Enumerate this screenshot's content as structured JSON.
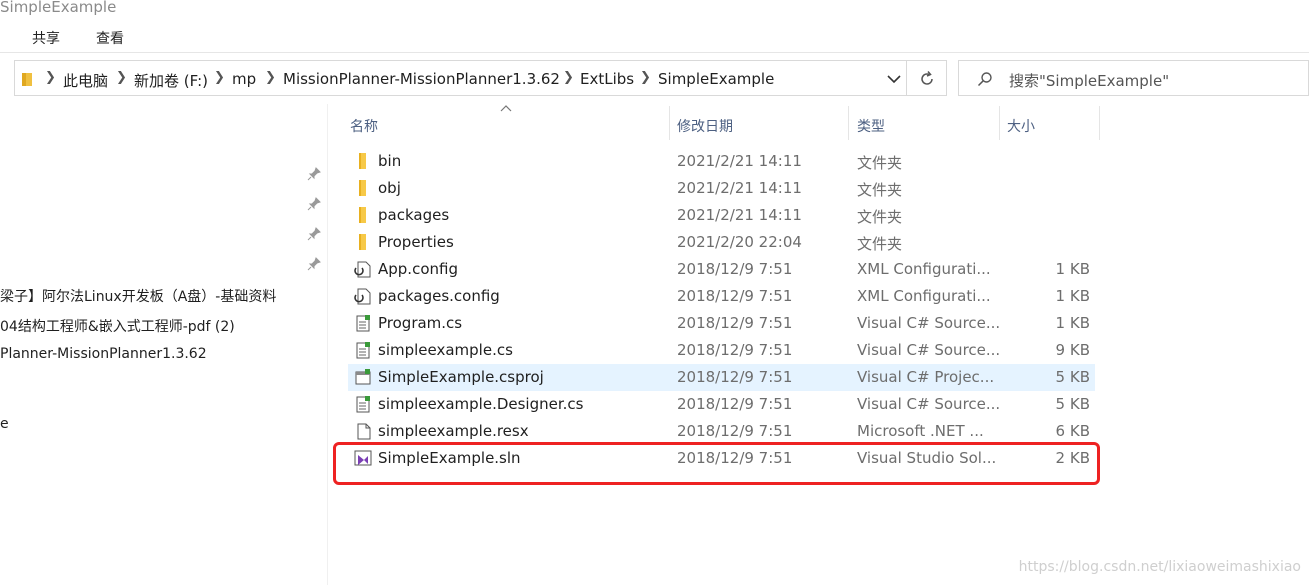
{
  "window": {
    "title": "SimpleExample"
  },
  "ribbon": {
    "tabs": [
      "共享",
      "查看"
    ]
  },
  "address_bar": {
    "breadcrumbs": [
      "此电脑",
      "新加卷 (F:)",
      "mp",
      "MissionPlanner-MissionPlanner1.3.62",
      "ExtLibs",
      "SimpleExample"
    ]
  },
  "search": {
    "placeholder": "搜索\"SimpleExample\""
  },
  "nav_pane": {
    "items": [
      "梁子】阿尔法Linux开发板（A盘）-基础资料",
      "04结构工程师&嵌入式工程师-pdf (2)",
      "Planner-MissionPlanner1.3.62",
      "e"
    ]
  },
  "columns": {
    "name": "名称",
    "date": "修改日期",
    "type": "类型",
    "size": "大小"
  },
  "files": [
    {
      "name": "bin",
      "date": "2021/2/21 14:11",
      "type": "文件夹",
      "size": "",
      "icon": "folder-icon"
    },
    {
      "name": "obj",
      "date": "2021/2/21 14:11",
      "type": "文件夹",
      "size": "",
      "icon": "folder-icon"
    },
    {
      "name": "packages",
      "date": "2021/2/21 14:11",
      "type": "文件夹",
      "size": "",
      "icon": "folder-icon"
    },
    {
      "name": "Properties",
      "date": "2021/2/20 22:04",
      "type": "文件夹",
      "size": "",
      "icon": "folder-icon"
    },
    {
      "name": "App.config",
      "date": "2018/12/9 7:51",
      "type": "XML Configurati...",
      "size": "1 KB",
      "icon": "config-file-icon"
    },
    {
      "name": "packages.config",
      "date": "2018/12/9 7:51",
      "type": "XML Configurati...",
      "size": "1 KB",
      "icon": "config-file-icon"
    },
    {
      "name": "Program.cs",
      "date": "2018/12/9 7:51",
      "type": "Visual C# Source...",
      "size": "1 KB",
      "icon": "csharp-file-icon"
    },
    {
      "name": "simpleexample.cs",
      "date": "2018/12/9 7:51",
      "type": "Visual C# Source...",
      "size": "9 KB",
      "icon": "csharp-file-icon"
    },
    {
      "name": "SimpleExample.csproj",
      "date": "2018/12/9 7:51",
      "type": "Visual C# Projec...",
      "size": "5 KB",
      "icon": "csproj-file-icon"
    },
    {
      "name": "simpleexample.Designer.cs",
      "date": "2018/12/9 7:51",
      "type": "Visual C# Source...",
      "size": "5 KB",
      "icon": "csharp-file-icon"
    },
    {
      "name": "simpleexample.resx",
      "date": "2018/12/9 7:51",
      "type": "Microsoft .NET ...",
      "size": "6 KB",
      "icon": "resx-file-icon"
    },
    {
      "name": "SimpleExample.sln",
      "date": "2018/12/9 7:51",
      "type": "Visual Studio Sol...",
      "size": "2 KB",
      "icon": "vs-solution-icon"
    }
  ],
  "watermark": "https://blog.csdn.net/lixiaoweimashixiao",
  "colors": {
    "selection": "#e5f3ff",
    "highlight_box": "#ee2222",
    "folder": "#f7c948"
  }
}
